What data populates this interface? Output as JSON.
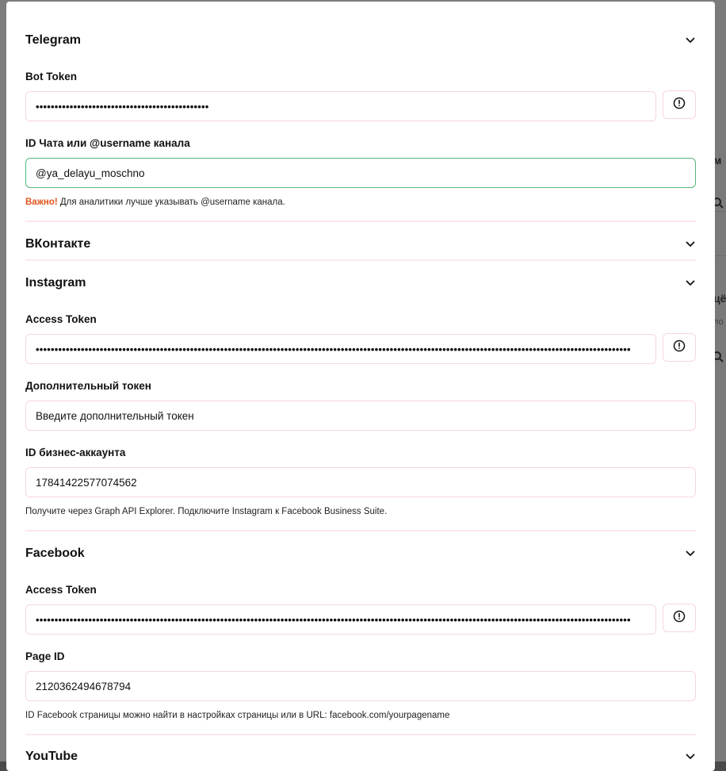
{
  "sections": {
    "telegram": {
      "title": "Telegram",
      "bot_token_label": "Bot Token",
      "bot_token_value": "••••••••••••••••••••••••••••••••••••••••••••••",
      "chat_id_label": "ID Чата или @username канала",
      "chat_id_value": "@ya_delayu_moschno",
      "hint_important": "Важно!",
      "hint_text": " Для аналитики лучше указывать @username канала."
    },
    "vk": {
      "title": "ВКонтакте"
    },
    "instagram": {
      "title": "Instagram",
      "access_token_label": "Access Token",
      "access_token_value": "••••••••••••••••••••••••••••••••••••••••••••••••••••••••••••••••••••••••••••••••••••••••••••••••••••••••••••••••••••••••••••••••••••••••••••••••••••••••••••••",
      "extra_token_label": "Дополнительный токен",
      "extra_token_placeholder": "Введите дополнительный токен",
      "business_id_label": "ID бизнес-аккаунта",
      "business_id_value": "17841422577074562",
      "hint_text": "Получите через Graph API Explorer. Подключите Instagram к Facebook Business Suite."
    },
    "facebook": {
      "title": "Facebook",
      "access_token_label": "Access Token",
      "access_token_value": "••••••••••••••••••••••••••••••••••••••••••••••••••••••••••••••••••••••••••••••••••••••••••••••••••••••••••••••••••••••••••••••••••••••••••••••••••••••••••••••",
      "page_id_label": "Page ID",
      "page_id_value": "2120362494678794",
      "hint_text": "ID Facebook страницы можно найти в настройках страницы или в URL: facebook.com/yourpagename"
    },
    "youtube": {
      "title": "YouTube"
    }
  },
  "background": {
    "glyph_1": "м",
    "glyph_2": "цё",
    "glyph_3": "ло"
  },
  "icons": {
    "chevron": "chevron-down-icon",
    "toggle_visibility": "alert-circle-icon"
  },
  "colors": {
    "accent_border": "#f6d6df",
    "focus_border": "#58b97a",
    "important": "#e0541c"
  }
}
